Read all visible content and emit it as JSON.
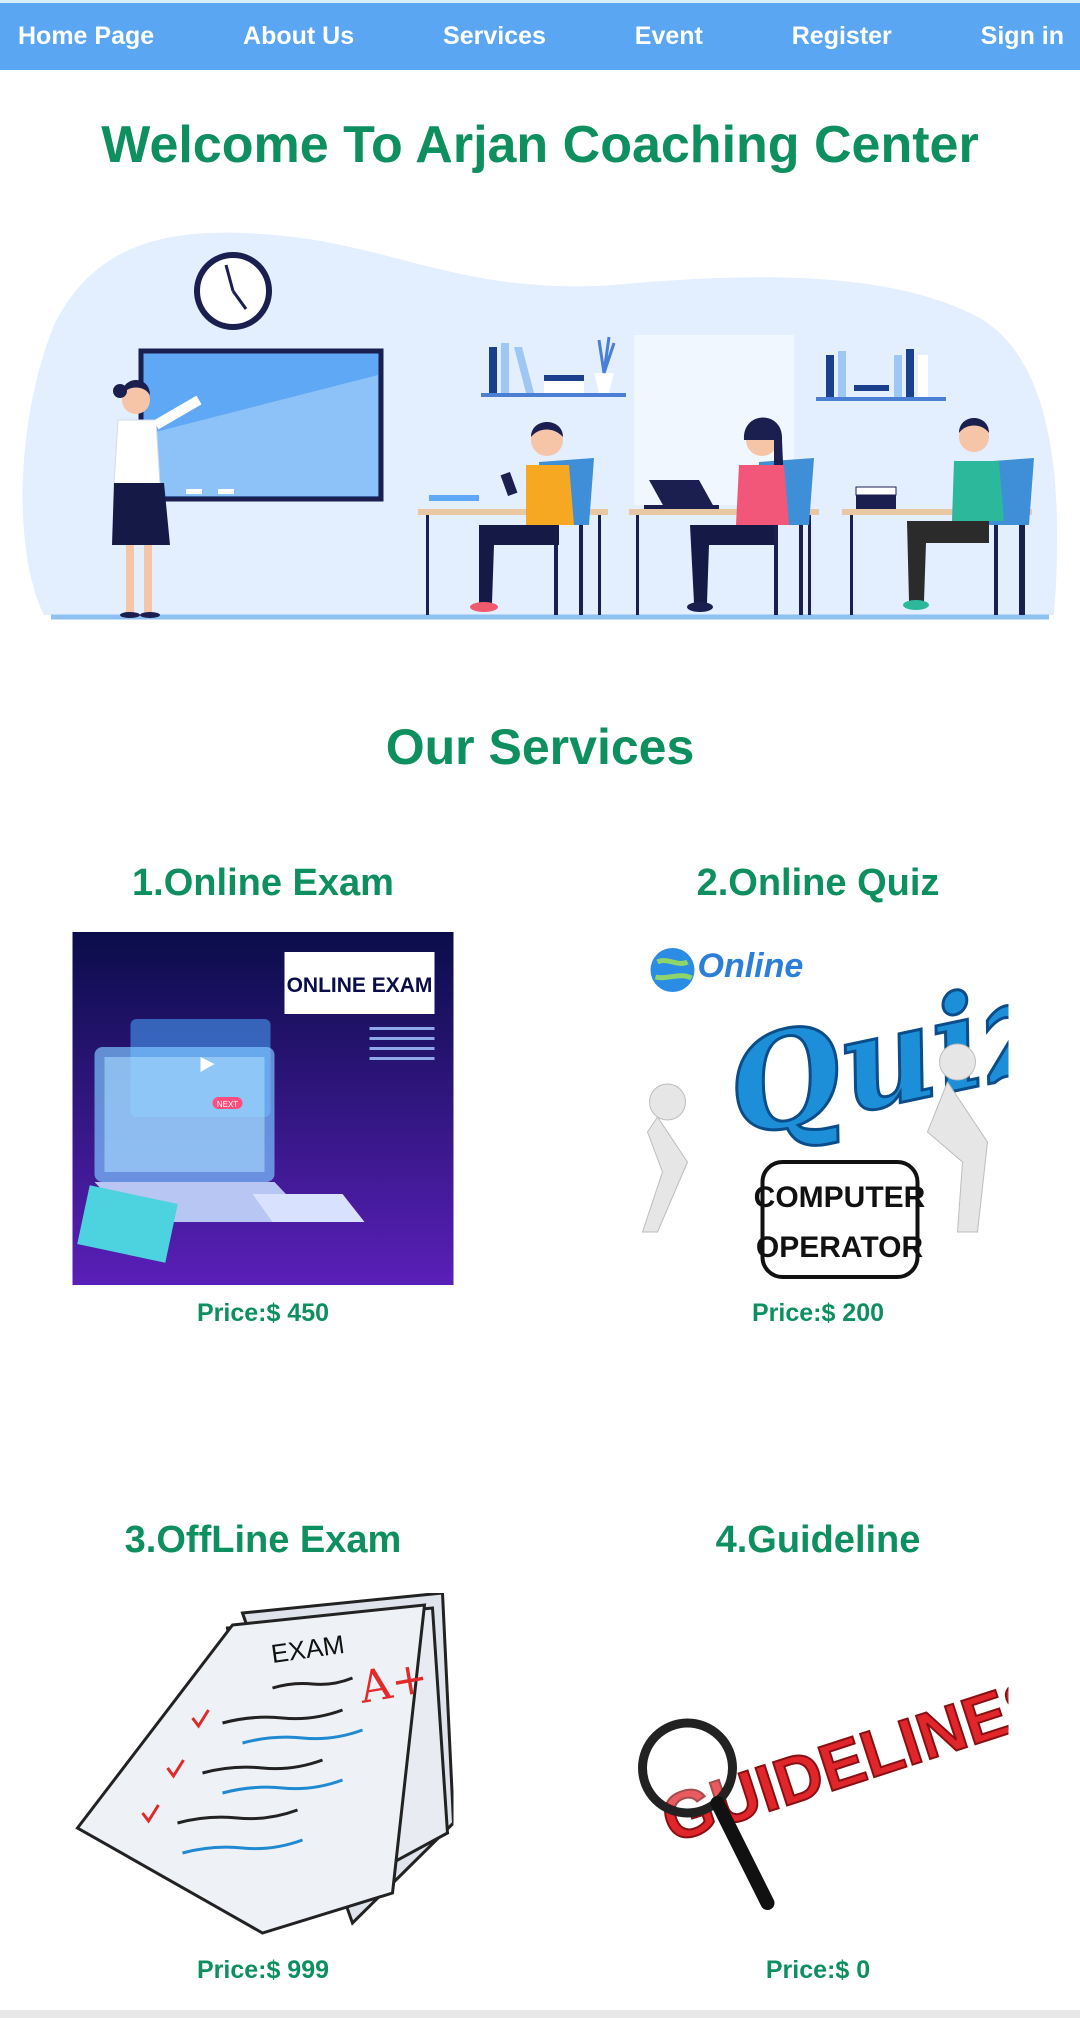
{
  "nav": {
    "items": [
      {
        "label": "Home Page"
      },
      {
        "label": "About Us"
      },
      {
        "label": "Services"
      },
      {
        "label": "Event"
      },
      {
        "label": "Register"
      },
      {
        "label": "Sign in"
      }
    ]
  },
  "hero": {
    "title": "Welcome To Arjan Coaching Center"
  },
  "services": {
    "title": "Our Services",
    "cards": [
      {
        "name": "1.Online Exam",
        "price": "Price:$ 450",
        "image_text": "ONLINE EXAM",
        "image_subtext": "NEXT"
      },
      {
        "name": "2.Online Quiz",
        "price": "Price:$ 200",
        "image_text": "Quiz",
        "image_subtext": "Online",
        "badge": [
          "COMPUTER",
          "OPERATOR"
        ]
      },
      {
        "name": "3.OffLine Exam",
        "price": "Price:$ 999",
        "image_text": "EXAM",
        "grade": "A+"
      },
      {
        "name": "4.Guideline",
        "price": "Price:$ 0",
        "image_text": "GUIDELINES"
      }
    ]
  },
  "colors": {
    "nav_bg": "#5aa6f3",
    "heading_green": "#0e8f5f",
    "hero_blob": "#e3effe"
  }
}
